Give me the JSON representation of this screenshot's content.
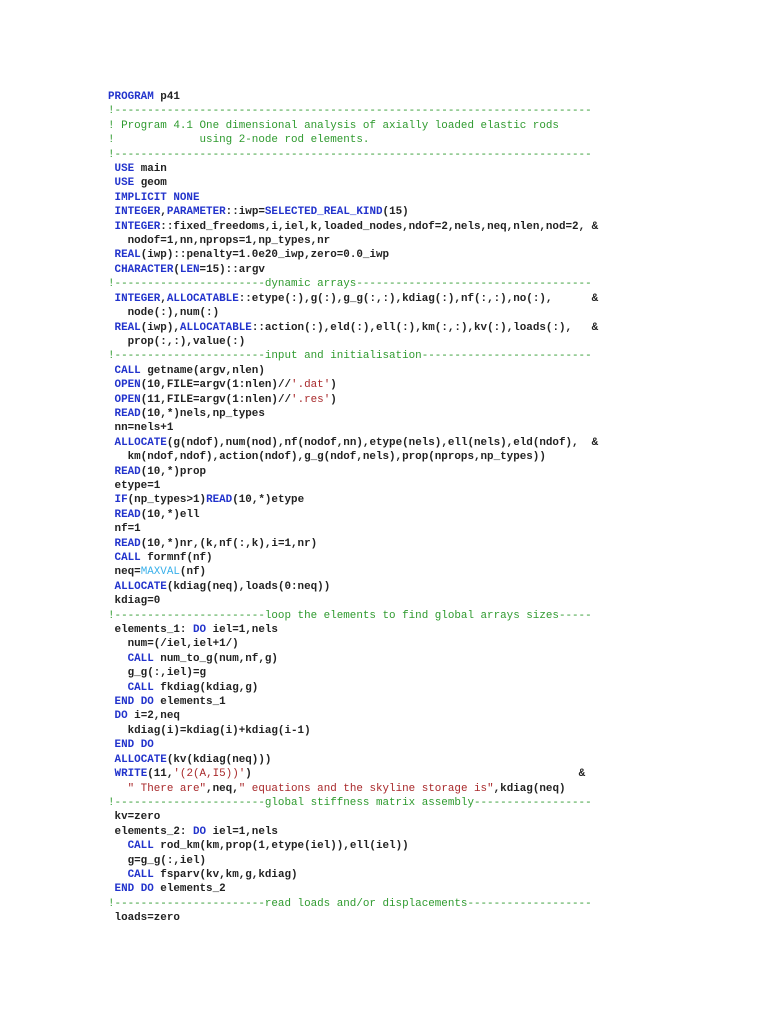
{
  "colors": {
    "keyword": "#2233cc",
    "comment": "#2e9a2e",
    "string": "#a8282a",
    "intrinsic": "#3ab0ea",
    "text": "#222222"
  },
  "lines": [
    [
      [
        "k",
        "PROGRAM"
      ],
      [
        "t",
        " p41"
      ]
    ],
    [
      [
        "c",
        "!-------------------------------------------------------------------------"
      ]
    ],
    [
      [
        "c",
        "! Program 4.1 One dimensional analysis of axially loaded elastic rods"
      ]
    ],
    [
      [
        "c",
        "!             using 2-node rod elements."
      ]
    ],
    [
      [
        "c",
        "!-------------------------------------------------------------------------"
      ]
    ],
    [
      [
        "t",
        " "
      ],
      [
        "k",
        "USE"
      ],
      [
        "t",
        " main"
      ]
    ],
    [
      [
        "t",
        " "
      ],
      [
        "k",
        "USE"
      ],
      [
        "t",
        " geom"
      ]
    ],
    [
      [
        "t",
        " "
      ],
      [
        "k",
        "IMPLICIT NONE"
      ]
    ],
    [
      [
        "t",
        " "
      ],
      [
        "k",
        "INTEGER"
      ],
      [
        "t",
        ","
      ],
      [
        "k",
        "PARAMETER"
      ],
      [
        "t",
        "::iwp="
      ],
      [
        "k",
        "SELECTED_REAL_KIND"
      ],
      [
        "t",
        "(15)"
      ]
    ],
    [
      [
        "t",
        " "
      ],
      [
        "k",
        "INTEGER"
      ],
      [
        "t",
        "::fixed_freedoms,i,iel,k,loaded_nodes,ndof=2,nels,neq,nlen,nod=2, &"
      ]
    ],
    [
      [
        "t",
        "   nodof=1,nn,nprops=1,np_types,nr"
      ]
    ],
    [
      [
        "t",
        " "
      ],
      [
        "k",
        "REAL"
      ],
      [
        "t",
        "(iwp)::penalty=1.0e20_iwp,zero=0.0_iwp"
      ]
    ],
    [
      [
        "t",
        " "
      ],
      [
        "k",
        "CHARACTER"
      ],
      [
        "t",
        "("
      ],
      [
        "k",
        "LEN"
      ],
      [
        "t",
        "=15)::argv"
      ]
    ],
    [
      [
        "c",
        "!-----------------------dynamic arrays------------------------------------"
      ]
    ],
    [
      [
        "t",
        " "
      ],
      [
        "k",
        "INTEGER"
      ],
      [
        "t",
        ","
      ],
      [
        "k",
        "ALLOCATABLE"
      ],
      [
        "t",
        "::etype(:),g(:),g_g(:,:),kdiag(:),nf(:,:),no(:),      &"
      ]
    ],
    [
      [
        "t",
        "   node(:),num(:)"
      ]
    ],
    [
      [
        "t",
        " "
      ],
      [
        "k",
        "REAL"
      ],
      [
        "t",
        "(iwp),"
      ],
      [
        "k",
        "ALLOCATABLE"
      ],
      [
        "t",
        "::action(:),eld(:),ell(:),km(:,:),kv(:),loads(:),   &"
      ]
    ],
    [
      [
        "t",
        "   prop(:,:),value(:)"
      ]
    ],
    [
      [
        "c",
        "!-----------------------input and initialisation--------------------------"
      ]
    ],
    [
      [
        "t",
        " "
      ],
      [
        "k",
        "CALL"
      ],
      [
        "t",
        " getname(argv,nlen)"
      ]
    ],
    [
      [
        "t",
        " "
      ],
      [
        "k",
        "OPEN"
      ],
      [
        "t",
        "(10,FILE=argv(1:nlen)//"
      ],
      [
        "s",
        "'.dat'"
      ],
      [
        "t",
        ")"
      ]
    ],
    [
      [
        "t",
        " "
      ],
      [
        "k",
        "OPEN"
      ],
      [
        "t",
        "(11,FILE=argv(1:nlen)//"
      ],
      [
        "s",
        "'.res'"
      ],
      [
        "t",
        ")"
      ]
    ],
    [
      [
        "t",
        " "
      ],
      [
        "k",
        "READ"
      ],
      [
        "t",
        "(10,*)nels,np_types"
      ]
    ],
    [
      [
        "t",
        " nn=nels+1"
      ]
    ],
    [
      [
        "t",
        " "
      ],
      [
        "k",
        "ALLOCATE"
      ],
      [
        "t",
        "(g(ndof),num(nod),nf(nodof,nn),etype(nels),ell(nels),eld(ndof),  &"
      ]
    ],
    [
      [
        "t",
        "   km(ndof,ndof),action(ndof),g_g(ndof,nels),prop(nprops,np_types))"
      ]
    ],
    [
      [
        "t",
        " "
      ],
      [
        "k",
        "READ"
      ],
      [
        "t",
        "(10,*)prop"
      ]
    ],
    [
      [
        "t",
        " etype=1"
      ]
    ],
    [
      [
        "t",
        " "
      ],
      [
        "k",
        "IF"
      ],
      [
        "t",
        "(np_types>1)"
      ],
      [
        "k",
        "READ"
      ],
      [
        "t",
        "(10,*)etype"
      ]
    ],
    [
      [
        "t",
        " "
      ],
      [
        "k",
        "READ"
      ],
      [
        "t",
        "(10,*)ell"
      ]
    ],
    [
      [
        "t",
        " nf=1"
      ]
    ],
    [
      [
        "t",
        " "
      ],
      [
        "k",
        "READ"
      ],
      [
        "t",
        "(10,*)nr,(k,nf(:,k),i=1,nr)"
      ]
    ],
    [
      [
        "t",
        " "
      ],
      [
        "k",
        "CALL"
      ],
      [
        "t",
        " formnf(nf)"
      ]
    ],
    [
      [
        "t",
        " neq="
      ],
      [
        "f",
        "MAXVAL"
      ],
      [
        "t",
        "(nf)"
      ]
    ],
    [
      [
        "t",
        " "
      ],
      [
        "k",
        "ALLOCATE"
      ],
      [
        "t",
        "(kdiag(neq),loads(0:neq))"
      ]
    ],
    [
      [
        "t",
        " kdiag=0"
      ]
    ],
    [
      [
        "c",
        "!-----------------------loop the elements to find global arrays sizes-----"
      ]
    ],
    [
      [
        "t",
        " elements_1: "
      ],
      [
        "k",
        "DO"
      ],
      [
        "t",
        " iel=1,nels"
      ]
    ],
    [
      [
        "t",
        "   num=(/iel,iel+1/)"
      ]
    ],
    [
      [
        "t",
        "   "
      ],
      [
        "k",
        "CALL"
      ],
      [
        "t",
        " num_to_g(num,nf,g)"
      ]
    ],
    [
      [
        "t",
        "   g_g(:,iel)=g"
      ]
    ],
    [
      [
        "t",
        "   "
      ],
      [
        "k",
        "CALL"
      ],
      [
        "t",
        " fkdiag(kdiag,g)"
      ]
    ],
    [
      [
        "t",
        " "
      ],
      [
        "k",
        "END DO"
      ],
      [
        "t",
        " elements_1"
      ]
    ],
    [
      [
        "t",
        " "
      ],
      [
        "k",
        "DO"
      ],
      [
        "t",
        " i=2,neq"
      ]
    ],
    [
      [
        "t",
        "   kdiag(i)=kdiag(i)+kdiag(i-1)"
      ]
    ],
    [
      [
        "t",
        " "
      ],
      [
        "k",
        "END DO"
      ]
    ],
    [
      [
        "t",
        " "
      ],
      [
        "k",
        "ALLOCATE"
      ],
      [
        "t",
        "(kv(kdiag(neq)))"
      ]
    ],
    [
      [
        "t",
        " "
      ],
      [
        "k",
        "WRITE"
      ],
      [
        "t",
        "(11,"
      ],
      [
        "s",
        "'(2(A,I5))'"
      ],
      [
        "t",
        ")                                                  &"
      ]
    ],
    [
      [
        "t",
        "   "
      ],
      [
        "s",
        "\" There are\""
      ],
      [
        "t",
        ",neq,"
      ],
      [
        "s",
        "\" equations and the skyline storage is\""
      ],
      [
        "t",
        ",kdiag(neq)"
      ]
    ],
    [
      [
        "c",
        "!-----------------------global stiffness matrix assembly------------------"
      ]
    ],
    [
      [
        "t",
        " kv=zero"
      ]
    ],
    [
      [
        "t",
        " elements_2: "
      ],
      [
        "k",
        "DO"
      ],
      [
        "t",
        " iel=1,nels"
      ]
    ],
    [
      [
        "t",
        "   "
      ],
      [
        "k",
        "CALL"
      ],
      [
        "t",
        " rod_km(km,prop(1,etype(iel)),ell(iel))"
      ]
    ],
    [
      [
        "t",
        "   g=g_g(:,iel)"
      ]
    ],
    [
      [
        "t",
        "   "
      ],
      [
        "k",
        "CALL"
      ],
      [
        "t",
        " fsparv(kv,km,g,kdiag)"
      ]
    ],
    [
      [
        "t",
        " "
      ],
      [
        "k",
        "END DO"
      ],
      [
        "t",
        " elements_2"
      ]
    ],
    [
      [
        "c",
        "!-----------------------read loads and/or displacements-------------------"
      ]
    ],
    [
      [
        "t",
        " loads=zero"
      ]
    ]
  ]
}
